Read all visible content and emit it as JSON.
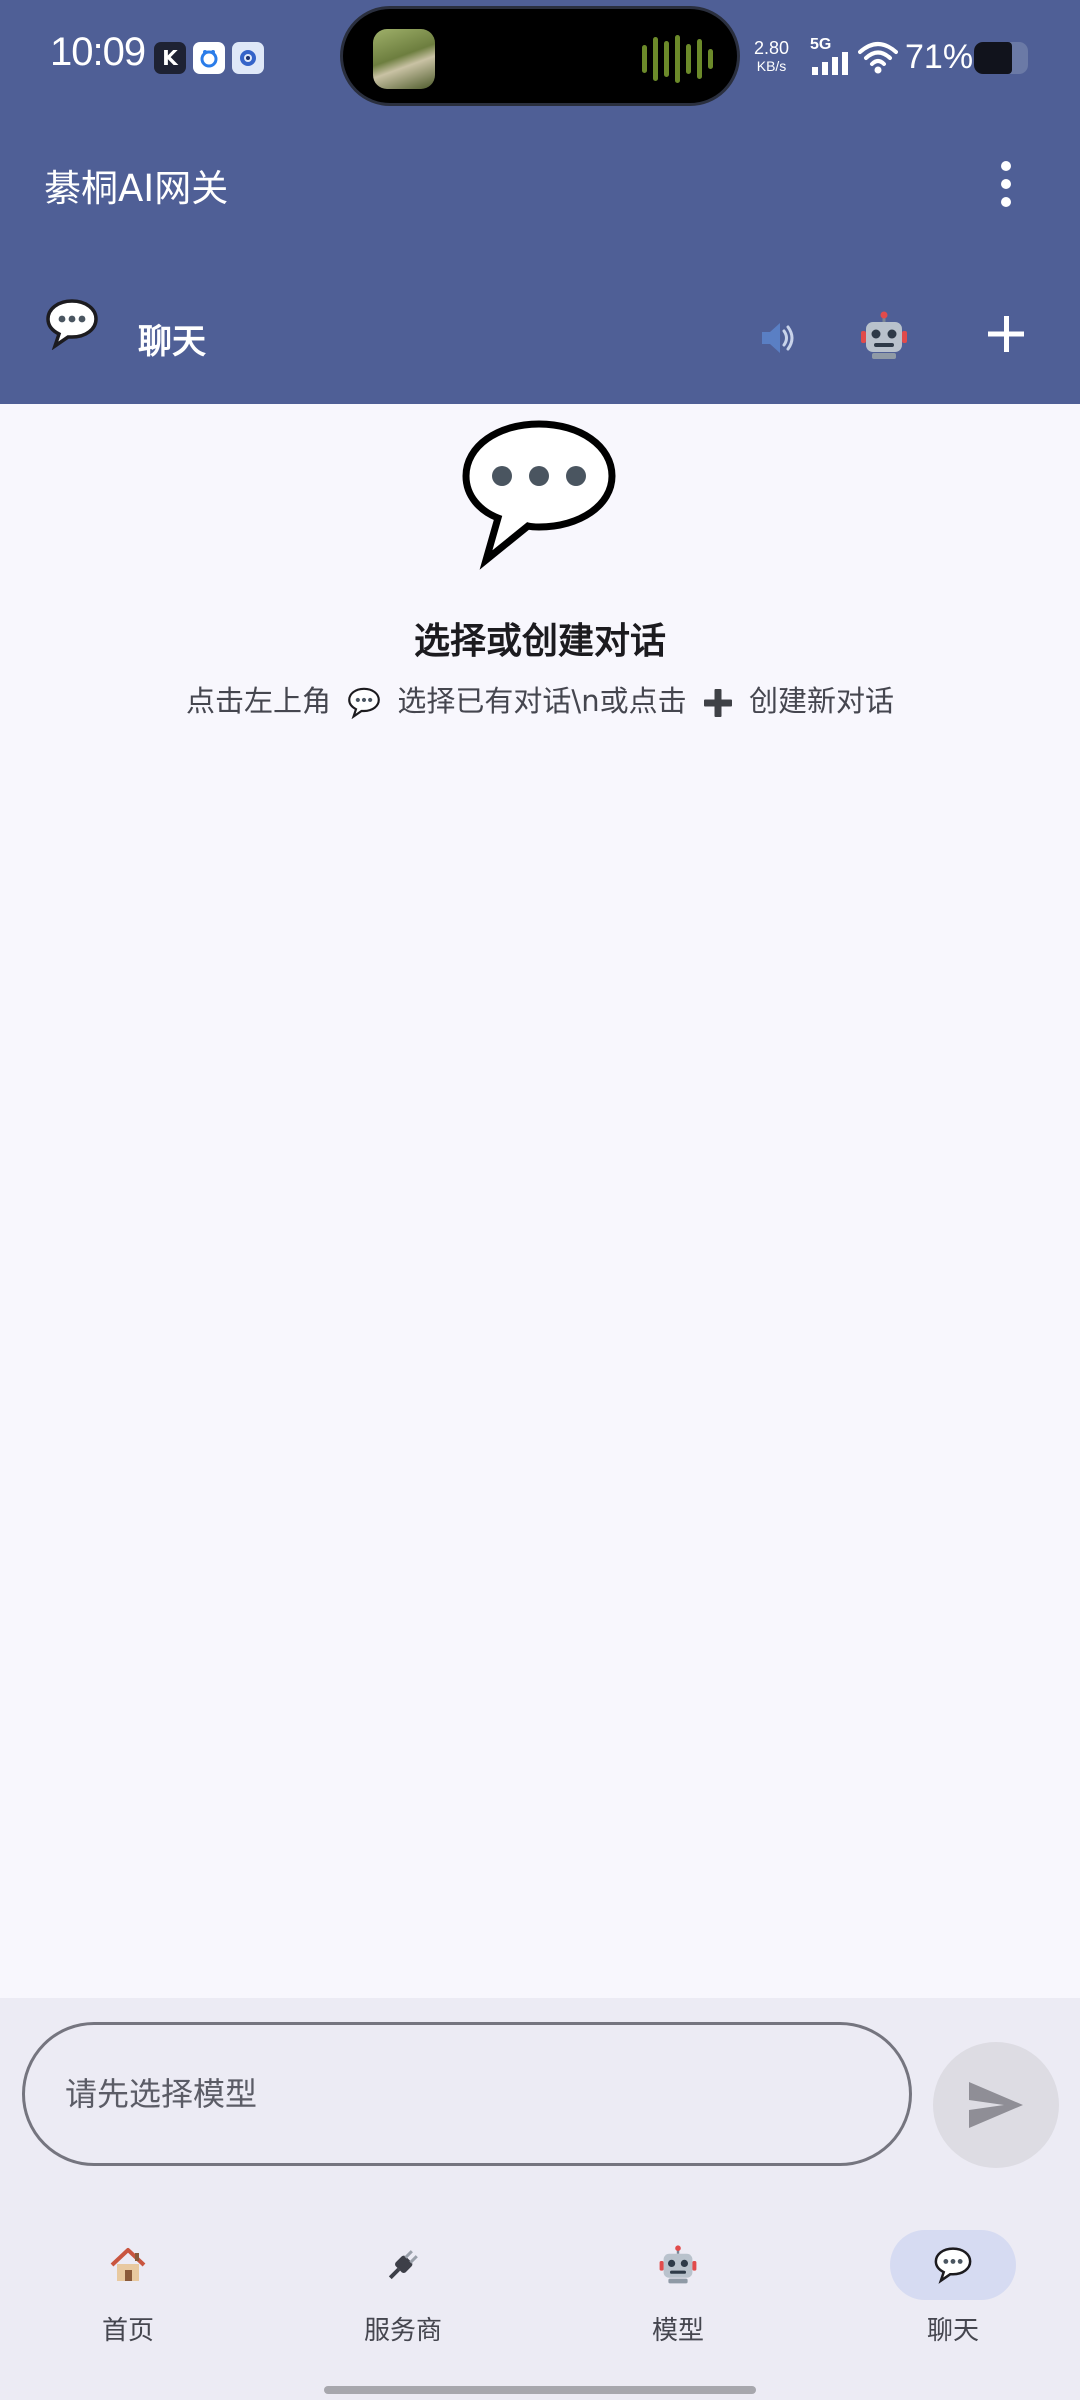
{
  "status_bar": {
    "time": "10:09",
    "network_speed_value": "2.80",
    "network_speed_unit": "KB/s",
    "network_type": "5G",
    "battery_percent": "71%",
    "battery_level": 0.71
  },
  "app_bar": {
    "title": "綦桐AI网关",
    "chat_tab_label": "聊天"
  },
  "empty_state": {
    "title": "选择或创建对话",
    "hint_part1": "点击左上角",
    "hint_part2": "选择已有对话\\n或点击",
    "hint_part3": "创建新对话"
  },
  "input": {
    "placeholder": "请先选择模型"
  },
  "bottom_nav": {
    "items": [
      {
        "label": "首页",
        "icon": "house-icon"
      },
      {
        "label": "服务商",
        "icon": "plug-icon"
      },
      {
        "label": "模型",
        "icon": "robot-icon"
      },
      {
        "label": "聊天",
        "icon": "speech-bubble-icon"
      }
    ],
    "active_index": 3
  },
  "colors": {
    "primary": "#4f5f96",
    "background": "#f8f7fd",
    "surface_container": "#ecebf4",
    "nav_active_indicator": "#d6dbf2"
  }
}
